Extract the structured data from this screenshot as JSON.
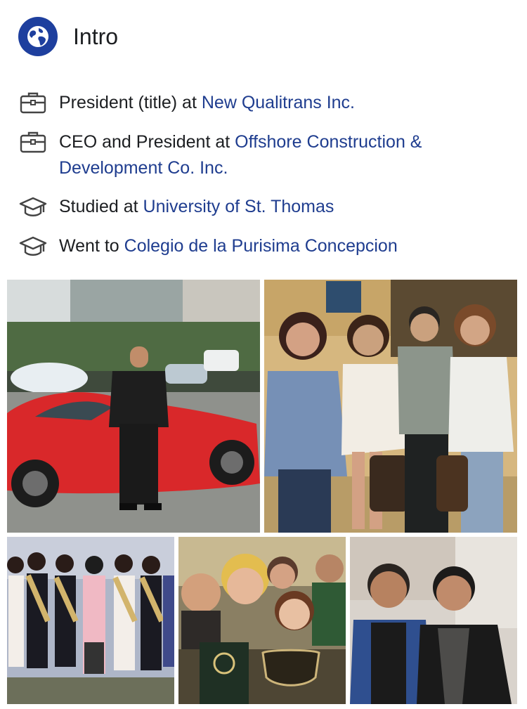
{
  "intro": {
    "title": "Intro"
  },
  "items": [
    {
      "icon": "briefcase-icon",
      "prefix": "President (title) at ",
      "link": "New Qualitrans Inc."
    },
    {
      "icon": "briefcase-icon",
      "prefix": "CEO and President at ",
      "link": "Offshore Construction & Development Co. Inc."
    },
    {
      "icon": "graduation-cap-icon",
      "prefix": "Studied at ",
      "link": "University of St. Thomas"
    },
    {
      "icon": "graduation-cap-icon",
      "prefix": "Went to ",
      "link": "Colegio de la Purisima Concepcion"
    }
  ],
  "photos": [
    {
      "name": "photo-man-with-red-car"
    },
    {
      "name": "photo-group-of-four"
    },
    {
      "name": "photo-pageant-group"
    },
    {
      "name": "photo-selfie-group"
    },
    {
      "name": "photo-two-men"
    }
  ],
  "colors": {
    "link": "#1f3d8f",
    "globe_bg": "#1e3f9e",
    "text": "#1c1e21"
  }
}
